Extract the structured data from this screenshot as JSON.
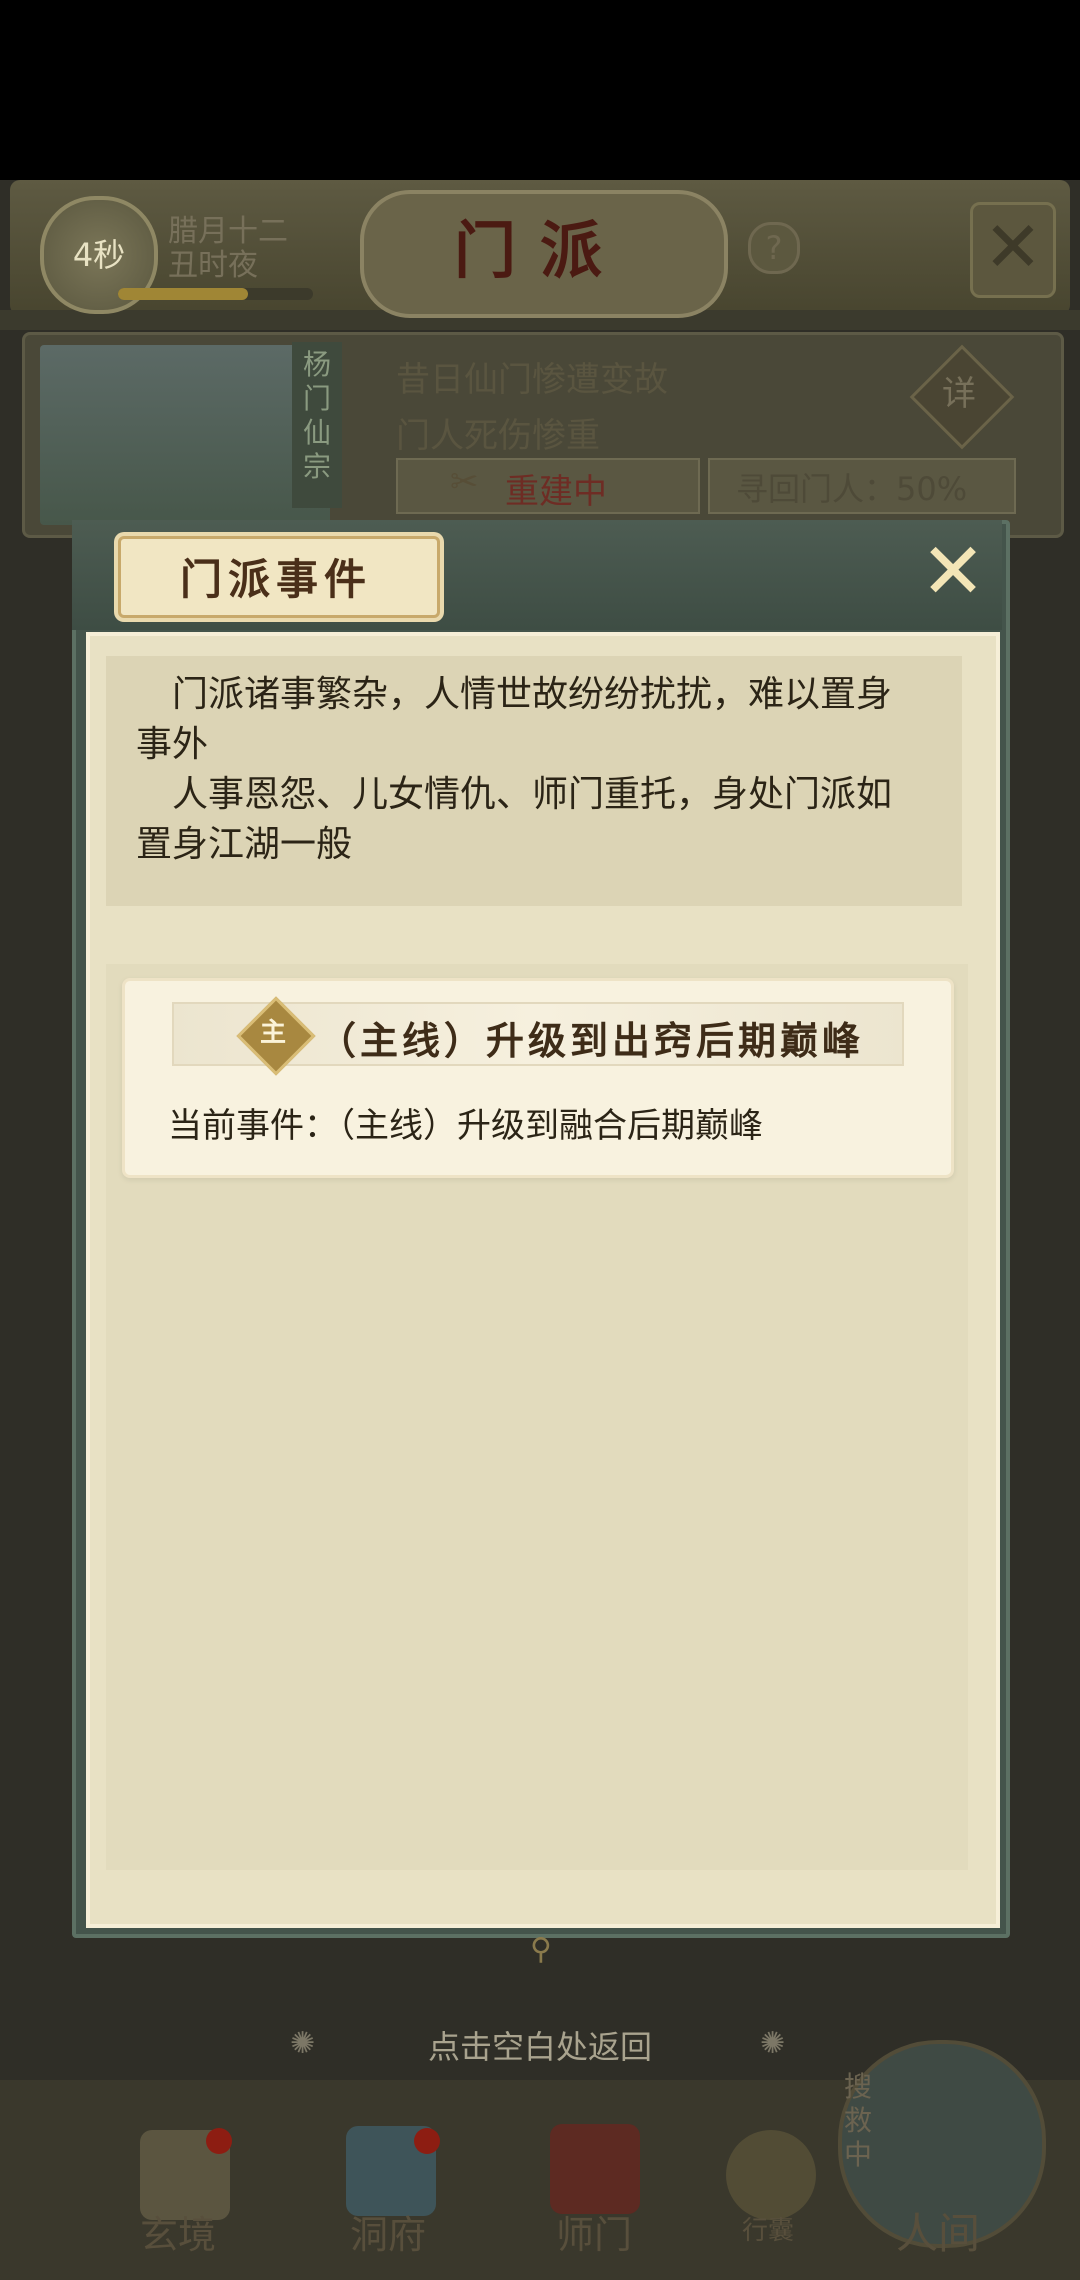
{
  "header": {
    "timer": "4秒",
    "date_line1": "腊月十二",
    "date_line2": "丑时夜",
    "title": "门派",
    "help_icon": "?",
    "close_icon": "✕"
  },
  "sect": {
    "name": "杨门仙宗",
    "description_line1": "昔日仙门惨遭变故",
    "description_line2": "门人死伤惨重",
    "detail_label": "详",
    "status_icon": "✂",
    "status_label": "重建中",
    "recover_label": "寻回门人：50%"
  },
  "modal": {
    "title": "门派事件",
    "close_icon": "✕",
    "intro": {
      "line1": "门派诸事繁杂，人情世故纷纷扰扰，难以置身事外",
      "line2": "人事恩怨、儿女情仇、师门重托，身处门派如置身江湖一般"
    },
    "events": [
      {
        "badge": "主",
        "title": "（主线）升级到出窍后期巅峰",
        "current": "当前事件：（主线）升级到融合后期巅峰"
      }
    ],
    "footer_hint": "点击空白处返回",
    "hint_deco": "✺"
  },
  "bottom_nav": {
    "items": [
      {
        "label": "玄境",
        "icon": "scroll-icon"
      },
      {
        "label": "洞府",
        "icon": "lantern-icon"
      },
      {
        "label": "师门",
        "icon": "banner-icon"
      },
      {
        "label": "行囊",
        "icon": "pouch-icon"
      },
      {
        "label": "人间",
        "icon": "world-icon"
      }
    ],
    "search_badge": "搜救中"
  },
  "colors": {
    "modal_frame": "#44544b",
    "modal_body": "#e8e1c4",
    "title_text": "#4a2f19",
    "accent_gold": "#a88840"
  }
}
